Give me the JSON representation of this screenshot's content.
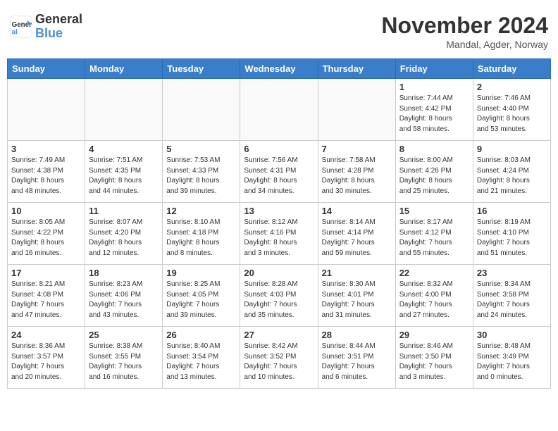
{
  "header": {
    "logo_line1": "General",
    "logo_line2": "Blue",
    "month_title": "November 2024",
    "subtitle": "Mandal, Agder, Norway"
  },
  "weekdays": [
    "Sunday",
    "Monday",
    "Tuesday",
    "Wednesday",
    "Thursday",
    "Friday",
    "Saturday"
  ],
  "weeks": [
    [
      {
        "day": "",
        "info": ""
      },
      {
        "day": "",
        "info": ""
      },
      {
        "day": "",
        "info": ""
      },
      {
        "day": "",
        "info": ""
      },
      {
        "day": "",
        "info": ""
      },
      {
        "day": "1",
        "info": "Sunrise: 7:44 AM\nSunset: 4:42 PM\nDaylight: 8 hours\nand 58 minutes."
      },
      {
        "day": "2",
        "info": "Sunrise: 7:46 AM\nSunset: 4:40 PM\nDaylight: 8 hours\nand 53 minutes."
      }
    ],
    [
      {
        "day": "3",
        "info": "Sunrise: 7:49 AM\nSunset: 4:38 PM\nDaylight: 8 hours\nand 48 minutes."
      },
      {
        "day": "4",
        "info": "Sunrise: 7:51 AM\nSunset: 4:35 PM\nDaylight: 8 hours\nand 44 minutes."
      },
      {
        "day": "5",
        "info": "Sunrise: 7:53 AM\nSunset: 4:33 PM\nDaylight: 8 hours\nand 39 minutes."
      },
      {
        "day": "6",
        "info": "Sunrise: 7:56 AM\nSunset: 4:31 PM\nDaylight: 8 hours\nand 34 minutes."
      },
      {
        "day": "7",
        "info": "Sunrise: 7:58 AM\nSunset: 4:28 PM\nDaylight: 8 hours\nand 30 minutes."
      },
      {
        "day": "8",
        "info": "Sunrise: 8:00 AM\nSunset: 4:26 PM\nDaylight: 8 hours\nand 25 minutes."
      },
      {
        "day": "9",
        "info": "Sunrise: 8:03 AM\nSunset: 4:24 PM\nDaylight: 8 hours\nand 21 minutes."
      }
    ],
    [
      {
        "day": "10",
        "info": "Sunrise: 8:05 AM\nSunset: 4:22 PM\nDaylight: 8 hours\nand 16 minutes."
      },
      {
        "day": "11",
        "info": "Sunrise: 8:07 AM\nSunset: 4:20 PM\nDaylight: 8 hours\nand 12 minutes."
      },
      {
        "day": "12",
        "info": "Sunrise: 8:10 AM\nSunset: 4:18 PM\nDaylight: 8 hours\nand 8 minutes."
      },
      {
        "day": "13",
        "info": "Sunrise: 8:12 AM\nSunset: 4:16 PM\nDaylight: 8 hours\nand 3 minutes."
      },
      {
        "day": "14",
        "info": "Sunrise: 8:14 AM\nSunset: 4:14 PM\nDaylight: 7 hours\nand 59 minutes."
      },
      {
        "day": "15",
        "info": "Sunrise: 8:17 AM\nSunset: 4:12 PM\nDaylight: 7 hours\nand 55 minutes."
      },
      {
        "day": "16",
        "info": "Sunrise: 8:19 AM\nSunset: 4:10 PM\nDaylight: 7 hours\nand 51 minutes."
      }
    ],
    [
      {
        "day": "17",
        "info": "Sunrise: 8:21 AM\nSunset: 4:08 PM\nDaylight: 7 hours\nand 47 minutes."
      },
      {
        "day": "18",
        "info": "Sunrise: 8:23 AM\nSunset: 4:06 PM\nDaylight: 7 hours\nand 43 minutes."
      },
      {
        "day": "19",
        "info": "Sunrise: 8:25 AM\nSunset: 4:05 PM\nDaylight: 7 hours\nand 39 minutes."
      },
      {
        "day": "20",
        "info": "Sunrise: 8:28 AM\nSunset: 4:03 PM\nDaylight: 7 hours\nand 35 minutes."
      },
      {
        "day": "21",
        "info": "Sunrise: 8:30 AM\nSunset: 4:01 PM\nDaylight: 7 hours\nand 31 minutes."
      },
      {
        "day": "22",
        "info": "Sunrise: 8:32 AM\nSunset: 4:00 PM\nDaylight: 7 hours\nand 27 minutes."
      },
      {
        "day": "23",
        "info": "Sunrise: 8:34 AM\nSunset: 3:58 PM\nDaylight: 7 hours\nand 24 minutes."
      }
    ],
    [
      {
        "day": "24",
        "info": "Sunrise: 8:36 AM\nSunset: 3:57 PM\nDaylight: 7 hours\nand 20 minutes."
      },
      {
        "day": "25",
        "info": "Sunrise: 8:38 AM\nSunset: 3:55 PM\nDaylight: 7 hours\nand 16 minutes."
      },
      {
        "day": "26",
        "info": "Sunrise: 8:40 AM\nSunset: 3:54 PM\nDaylight: 7 hours\nand 13 minutes."
      },
      {
        "day": "27",
        "info": "Sunrise: 8:42 AM\nSunset: 3:52 PM\nDaylight: 7 hours\nand 10 minutes."
      },
      {
        "day": "28",
        "info": "Sunrise: 8:44 AM\nSunset: 3:51 PM\nDaylight: 7 hours\nand 6 minutes."
      },
      {
        "day": "29",
        "info": "Sunrise: 8:46 AM\nSunset: 3:50 PM\nDaylight: 7 hours\nand 3 minutes."
      },
      {
        "day": "30",
        "info": "Sunrise: 8:48 AM\nSunset: 3:49 PM\nDaylight: 7 hours\nand 0 minutes."
      }
    ]
  ]
}
